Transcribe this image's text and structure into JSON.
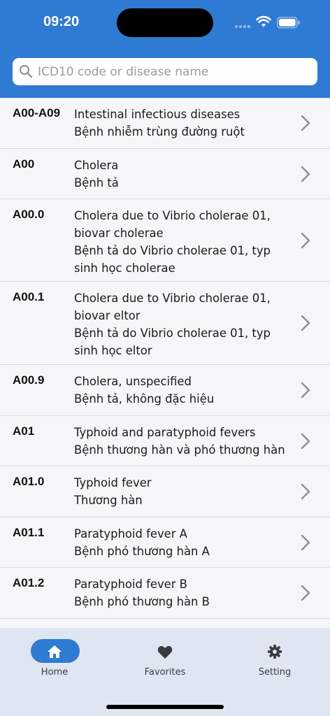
{
  "status_bar": {
    "time": "09:20"
  },
  "search": {
    "placeholder": "ICD10 code or disease name",
    "value": ""
  },
  "rows": [
    {
      "code": "A00-A09",
      "lines": [
        "Intestinal infectious diseases",
        "Bệnh nhiễm trùng đường ruột"
      ]
    },
    {
      "code": "A00",
      "lines": [
        "Cholera",
        "Bệnh tả"
      ]
    },
    {
      "code": "A00.0",
      "lines": [
        "Cholera due to Vibrio cholerae 01,",
        "biovar cholerae",
        "Bệnh tả do Vibrio cholerae 01, typ",
        "sinh học cholerae"
      ]
    },
    {
      "code": "A00.1",
      "lines": [
        "Cholera due to Vibrio cholerae 01,",
        "biovar eltor",
        "Bệnh tả do Vibrio cholerae 01, typ",
        "sinh học eltor"
      ]
    },
    {
      "code": "A00.9",
      "lines": [
        "Cholera, unspecified",
        "Bệnh tả, không đặc hiệu"
      ]
    },
    {
      "code": "A01",
      "lines": [
        "Typhoid and paratyphoid fevers",
        "Bệnh thương hàn và phó thương hàn"
      ]
    },
    {
      "code": "A01.0",
      "lines": [
        "Typhoid fever",
        "Thương hàn"
      ]
    },
    {
      "code": "A01.1",
      "lines": [
        "Paratyphoid fever A",
        "Bệnh phó thương hàn A"
      ]
    },
    {
      "code": "A01.2",
      "lines": [
        "Paratyphoid fever B",
        "Bệnh phó thương hàn B"
      ]
    }
  ],
  "tabbar": {
    "home": "Home",
    "favorites": "Favorites",
    "setting": "Setting"
  },
  "colors": {
    "accent": "#2f7ad3",
    "tabbar_bg": "#dfe6f1"
  }
}
